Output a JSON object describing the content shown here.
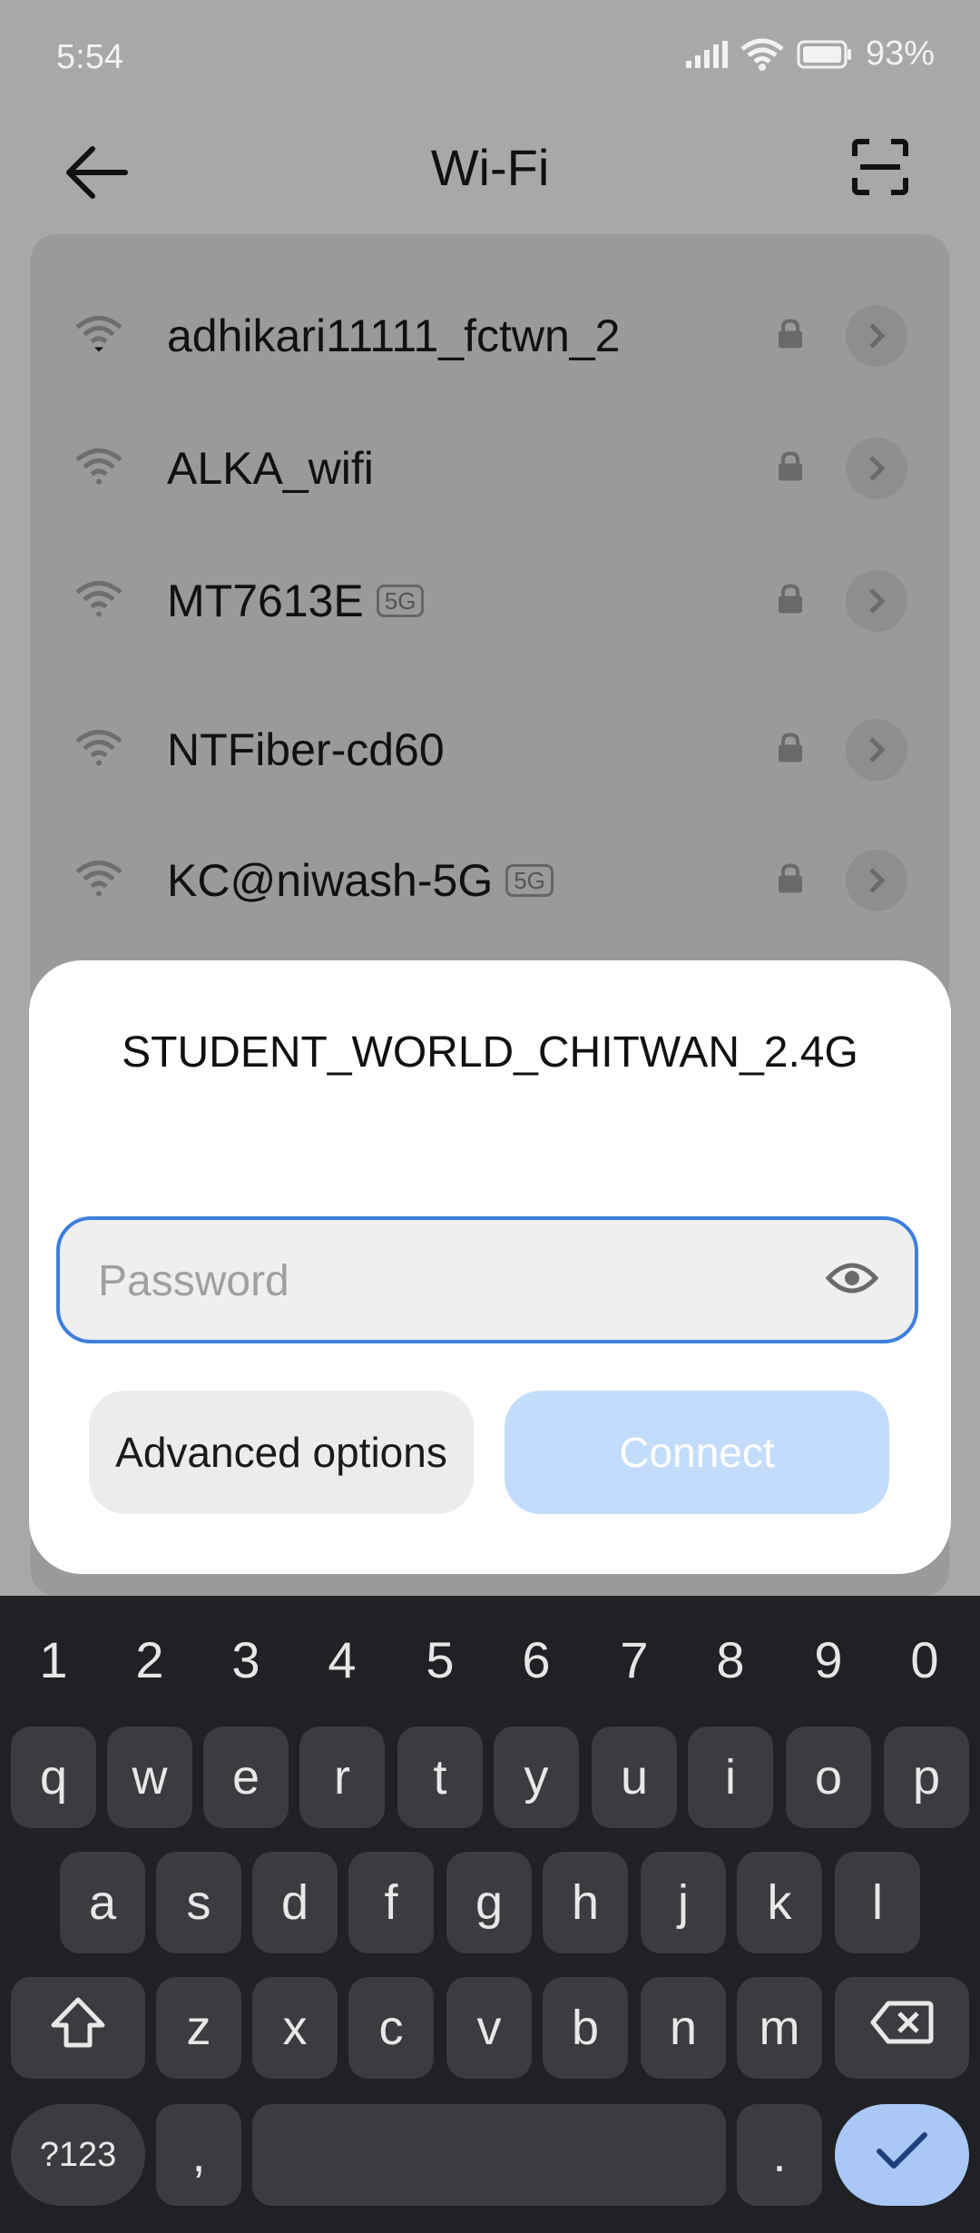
{
  "status_bar": {
    "time": "5:54",
    "battery": "93%"
  },
  "header": {
    "title": "Wi-Fi"
  },
  "networks": [
    {
      "name": "adhikari11111_fctwn_2",
      "band": ""
    },
    {
      "name": "ALKA_wifi",
      "band": ""
    },
    {
      "name": "MT7613E",
      "band": "5G"
    },
    {
      "name": "NTFiber-cd60",
      "band": ""
    },
    {
      "name": "KC@niwash-5G",
      "band": "5G"
    }
  ],
  "dialog": {
    "network_name": "STUDENT_WORLD_CHITWAN_2.4G",
    "password": {
      "value": "",
      "placeholder": "Password"
    },
    "advanced_label": "Advanced options",
    "connect_label": "Connect"
  },
  "keyboard": {
    "numbers": [
      "1",
      "2",
      "3",
      "4",
      "5",
      "6",
      "7",
      "8",
      "9",
      "0"
    ],
    "row1": [
      "q",
      "w",
      "e",
      "r",
      "t",
      "y",
      "u",
      "i",
      "o",
      "p"
    ],
    "row2": [
      "a",
      "s",
      "d",
      "f",
      "g",
      "h",
      "j",
      "k",
      "l"
    ],
    "row3": [
      "z",
      "x",
      "c",
      "v",
      "b",
      "n",
      "m"
    ],
    "symbols_label": "?123",
    "comma_label": ",",
    "period_label": "."
  },
  "colors": {
    "accent": "#3d7fdc",
    "connect_disabled": "#c4dcfb",
    "keyboard_bg": "#1f2124",
    "key_bg": "#3a3c40"
  }
}
